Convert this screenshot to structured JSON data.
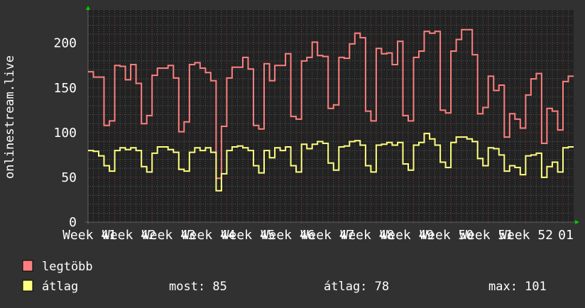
{
  "chart_data": {
    "type": "line",
    "step": true,
    "ylabel": "onlinestream.live",
    "xlabel": "",
    "ylim": [
      0,
      237
    ],
    "yticks": [
      0,
      50,
      100,
      150,
      200
    ],
    "x_tick_labels": [
      "Week 41",
      "Week 42",
      "Week 43",
      "Week 44",
      "Week 45",
      "Week 46",
      "Week 47",
      "Week 48",
      "Week 49",
      "Week 50",
      "Week 51",
      "Week 52",
      "01"
    ],
    "grid": true,
    "legend_placement": "bottom-left",
    "colors": {
      "background": "#313131",
      "plot": "#222222",
      "grid_major": "#7a3a3a",
      "grid_minor": "#555555",
      "arrow": "#00cc00"
    },
    "series": [
      {
        "name": "legtöbb",
        "color": "#ff7f7f",
        "values": [
          168,
          162,
          162,
          108,
          113,
          175,
          174,
          159,
          176,
          155,
          110,
          119,
          164,
          172,
          172,
          175,
          161,
          101,
          112,
          176,
          178,
          172,
          167,
          158,
          49,
          107,
          161,
          173,
          173,
          184,
          171,
          108,
          104,
          177,
          158,
          175,
          175,
          188,
          118,
          115,
          180,
          184,
          201,
          186,
          185,
          127,
          131,
          184,
          183,
          199,
          211,
          206,
          124,
          113,
          194,
          188,
          189,
          176,
          202,
          119,
          113,
          184,
          191,
          213,
          211,
          213,
          125,
          122,
          191,
          204,
          215,
          215,
          187,
          121,
          128,
          163,
          147,
          153,
          95,
          121,
          115,
          105,
          142,
          160,
          166,
          88,
          127,
          124,
          103,
          157,
          163
        ]
      },
      {
        "name": "átlag",
        "color": "#ffff80",
        "values": [
          80,
          79,
          74,
          63,
          57,
          80,
          83,
          81,
          83,
          80,
          62,
          56,
          77,
          84,
          84,
          81,
          78,
          59,
          57,
          78,
          83,
          80,
          83,
          78,
          35,
          54,
          80,
          84,
          85,
          83,
          80,
          63,
          55,
          80,
          72,
          83,
          80,
          84,
          63,
          56,
          87,
          82,
          87,
          90,
          88,
          66,
          58,
          84,
          85,
          90,
          91,
          86,
          63,
          56,
          86,
          87,
          89,
          86,
          89,
          65,
          58,
          86,
          89,
          99,
          93,
          86,
          67,
          61,
          89,
          95,
          95,
          93,
          90,
          71,
          63,
          83,
          82,
          75,
          57,
          63,
          61,
          53,
          74,
          75,
          77,
          50,
          62,
          67,
          56,
          83,
          84
        ]
      }
    ]
  },
  "legend": {
    "items": [
      {
        "label": "legtöbb",
        "color": "#ff7f7f"
      },
      {
        "label": "átlag",
        "color": "#ffff80"
      }
    ],
    "stats": {
      "now": "most: 85",
      "avg": "átlag: 78",
      "max": "max: 101"
    }
  }
}
